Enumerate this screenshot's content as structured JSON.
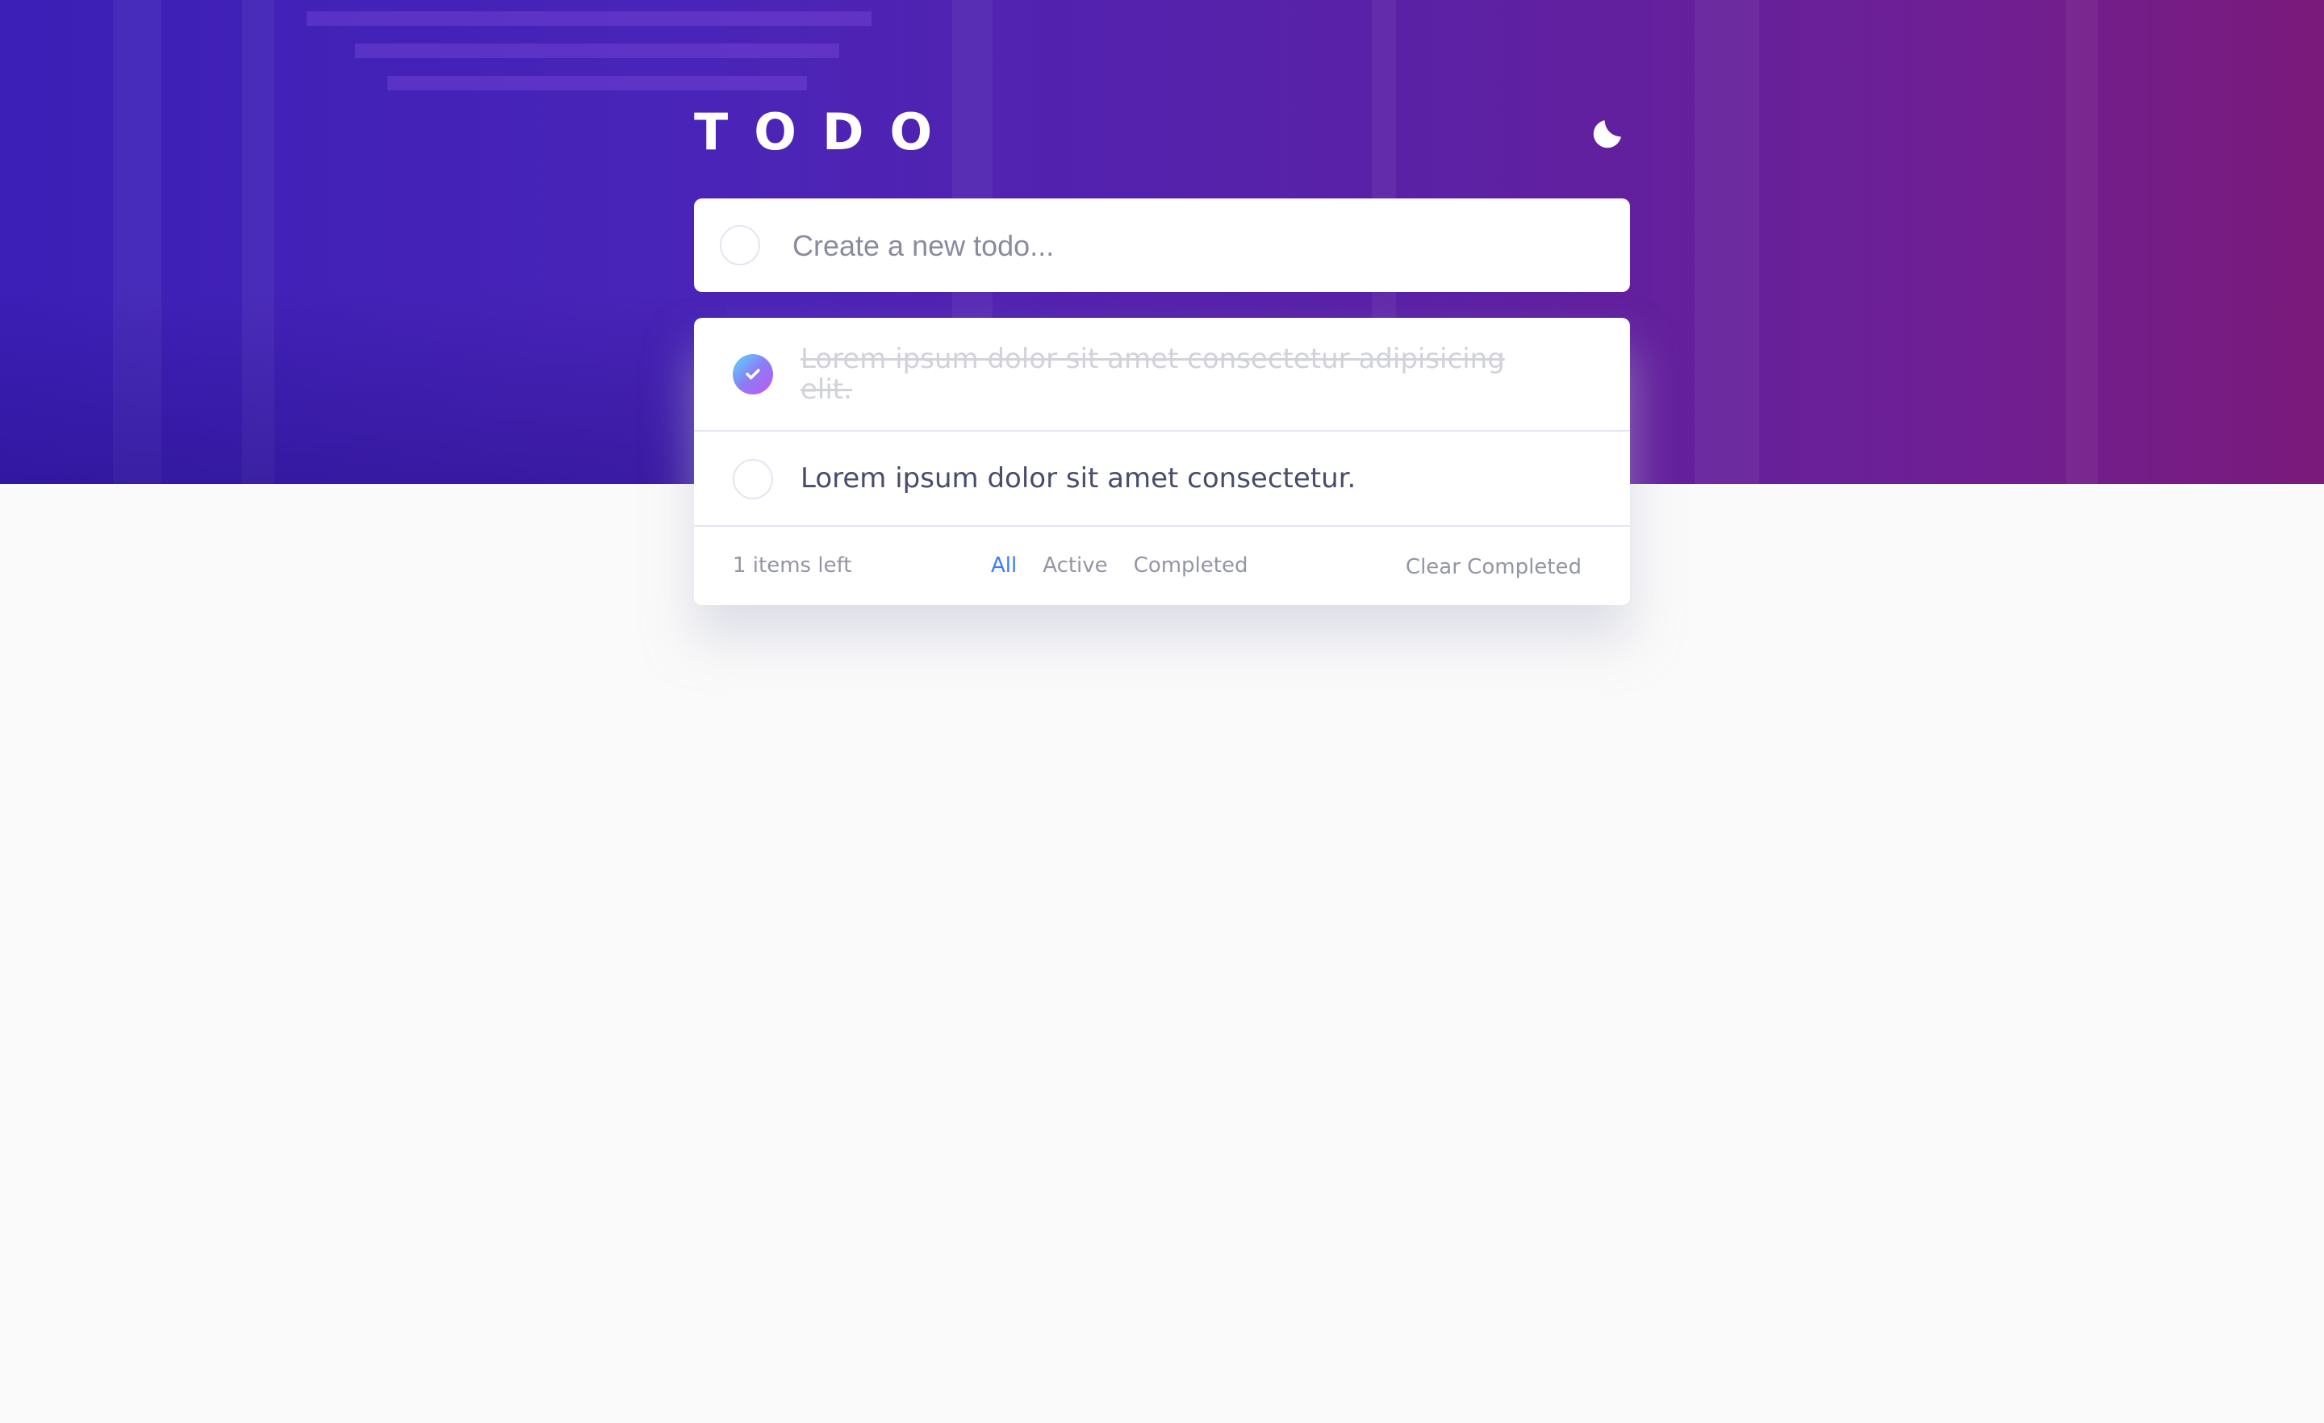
{
  "app": {
    "title": "TODO"
  },
  "new_todo": {
    "placeholder": "Create a new todo..."
  },
  "todos": [
    {
      "text": "Lorem ipsum dolor sit amet consectetur adipisicing elit.",
      "completed": true
    },
    {
      "text": "Lorem ipsum dolor sit amet consectetur.",
      "completed": false
    }
  ],
  "footer": {
    "items_left": "1 items left",
    "filters": [
      "All",
      "Active",
      "Completed"
    ],
    "active_filter": "All",
    "clear_label": "Clear Completed"
  },
  "icons": {
    "theme_toggle": "moon-icon",
    "check": "check-icon"
  },
  "colors": {
    "accent": "#3a7cfd",
    "check_gradient_start": "#55ddff",
    "check_gradient_end": "#c058f3",
    "text_primary": "#494c6b",
    "text_completed": "#d1d2da",
    "text_muted": "#9495a5",
    "background": "#fafafa"
  }
}
